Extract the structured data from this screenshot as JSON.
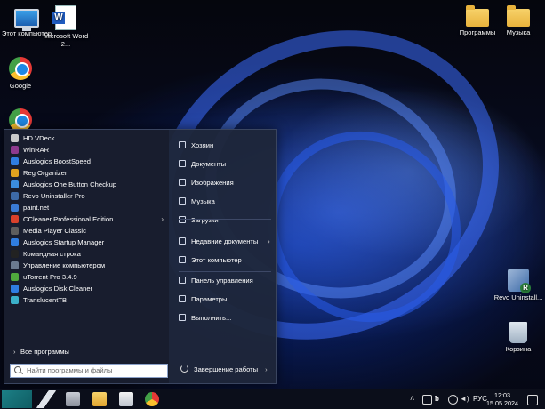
{
  "desktop": {
    "icons": [
      {
        "label": "Этот компьютер",
        "icon": "monitor-icon"
      },
      {
        "label": "Microsoft Word 2...",
        "icon": "word-icon"
      },
      {
        "label": "Google",
        "icon": "chrome-icon"
      },
      {
        "label": "Программы",
        "icon": "folder-icon"
      },
      {
        "label": "Музыка",
        "icon": "folder-icon"
      },
      {
        "label": "Revo Uninstall...",
        "icon": "revo-uninstaller-icon"
      },
      {
        "label": "Корзина",
        "icon": "recycle-bin-icon"
      }
    ]
  },
  "start_menu": {
    "apps": [
      {
        "label": "HD VDeck",
        "color": "#c9c9c9"
      },
      {
        "label": "WinRAR",
        "color": "#8e3a8e"
      },
      {
        "label": "Auslogics BoostSpeed",
        "color": "#2f7de1"
      },
      {
        "label": "Reg Organizer",
        "color": "#e0a21f"
      },
      {
        "label": "Auslogics One Button Checkup",
        "color": "#3b8de0"
      },
      {
        "label": "Revo Uninstaller Pro",
        "color": "#3d6aa8"
      },
      {
        "label": "paint.net",
        "color": "#3a7bd5"
      },
      {
        "label": "CCleaner Professional Edition",
        "color": "#d9412b",
        "has_arrow": true
      },
      {
        "label": "Media Player Classic",
        "color": "#5e5e5e"
      },
      {
        "label": "Auslogics Startup Manager",
        "color": "#2f7de1"
      },
      {
        "label": "Командная строка",
        "color": "#222222"
      },
      {
        "label": "Управление компьютером",
        "color": "#6b7a90"
      },
      {
        "label": "uTorrent Pro 3.4.9",
        "color": "#4fa83d"
      },
      {
        "label": "Auslogics Disk Cleaner",
        "color": "#2f7de1"
      },
      {
        "label": "TranslucentTB",
        "color": "#3bb0c9"
      }
    ],
    "all_programs": "Все программы",
    "search_placeholder": "Найти программы и файлы",
    "places": [
      {
        "label": "Хозяин",
        "icon": "user-icon"
      },
      {
        "label": "Документы",
        "icon": "documents-icon"
      },
      {
        "label": "Изображения",
        "icon": "pictures-icon"
      },
      {
        "label": "Музыка",
        "icon": "music-icon"
      },
      {
        "label": "Загрузки",
        "icon": "downloads-icon"
      },
      {
        "label": "Недавние документы",
        "icon": "recent-icon",
        "has_arrow": true
      },
      {
        "label": "Этот компьютер",
        "icon": "computer-icon"
      },
      {
        "label": "Панель управления",
        "icon": "control-panel-icon"
      },
      {
        "label": "Параметры",
        "icon": "settings-icon"
      },
      {
        "label": "Выполнить...",
        "icon": "run-icon"
      }
    ],
    "shutdown_label": "Завершение работы"
  },
  "taskbar": {
    "pinned": [
      "start-button",
      "task-view-icon",
      "file-explorer-icon",
      "store-icon",
      "chrome-icon"
    ],
    "tray": {
      "language": "РУС",
      "time": "12:03",
      "date": "15.05.2024"
    }
  }
}
